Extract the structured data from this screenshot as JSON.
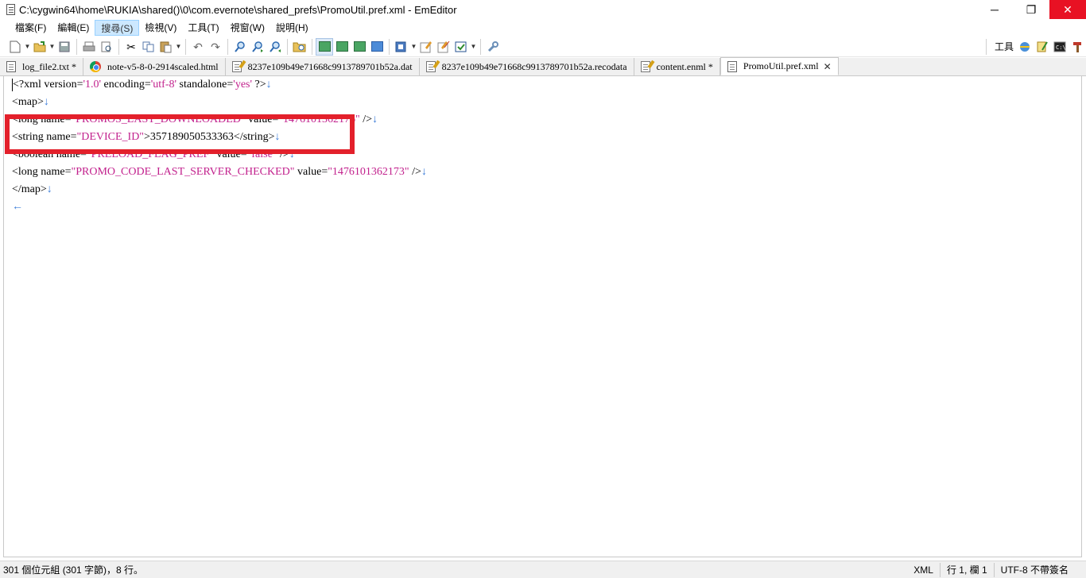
{
  "window": {
    "title": "C:\\cygwin64\\home\\RUKIA\\shared()\\0\\com.evernote\\shared_prefs\\PromoUtil.pref.xml - EmEditor",
    "minimize": "─",
    "restore": "❐",
    "close": "✕"
  },
  "menu": {
    "items": [
      "檔案(F)",
      "編輯(E)",
      "搜尋(S)",
      "檢視(V)",
      "工具(T)",
      "視窗(W)",
      "說明(H)"
    ],
    "active_index": 2
  },
  "toolbar": {
    "tools_label": "工具"
  },
  "tabs": [
    {
      "label": "log_file2.txt *",
      "icon": "document-icon"
    },
    {
      "label": "note-v5-8-0-2914scaled.html",
      "icon": "chrome-icon"
    },
    {
      "label": "8237e109b49e71668c9913789701b52a.dat",
      "icon": "edit-document-icon"
    },
    {
      "label": "8237e109b49e71668c9913789701b52a.recodata",
      "icon": "edit-document-icon"
    },
    {
      "label": "content.enml *",
      "icon": "edit-document-icon"
    },
    {
      "label": "PromoUtil.pref.xml",
      "icon": "document-icon",
      "active": true,
      "close": "✕"
    }
  ],
  "editor": {
    "line1": {
      "a": "<?xml version=",
      "b": "'1.0'",
      "c": " encoding=",
      "d": "'utf-8'",
      "e": " standalone=",
      "f": "'yes'",
      "g": " ?>"
    },
    "line2": {
      "a": "<map>"
    },
    "line3": {
      "a": "<long name=",
      "b": "\"PROMOS_LAST_DOWNLOADED\"",
      "c": " value=",
      "d": "\"1476101362176\"",
      "e": " />"
    },
    "line4": {
      "a": "<string name=",
      "b": "\"DEVICE_ID\"",
      "c": ">357189050533363</string>"
    },
    "line5": {
      "a": "<boolean name=",
      "b": "\"PRELOAD_FLAG_PREF\"",
      "c": " value=",
      "d": "\"false\"",
      "e": " />"
    },
    "line6": {
      "a": "<long name=",
      "b": "\"PROMO_CODE_LAST_SERVER_CHECKED\"",
      "c": " value=",
      "d": "\"1476101362173\"",
      "e": " />"
    },
    "line7": {
      "a": "</map>"
    },
    "newline_mark": "↓",
    "eof_mark": "←",
    "highlight_color": "#e3202b"
  },
  "status": {
    "summary": "301 個位元組 (301 字節)，8 行。",
    "syntax": "XML",
    "position": "行 1, 欄 1",
    "encoding": "UTF-8 不帶簽名"
  }
}
